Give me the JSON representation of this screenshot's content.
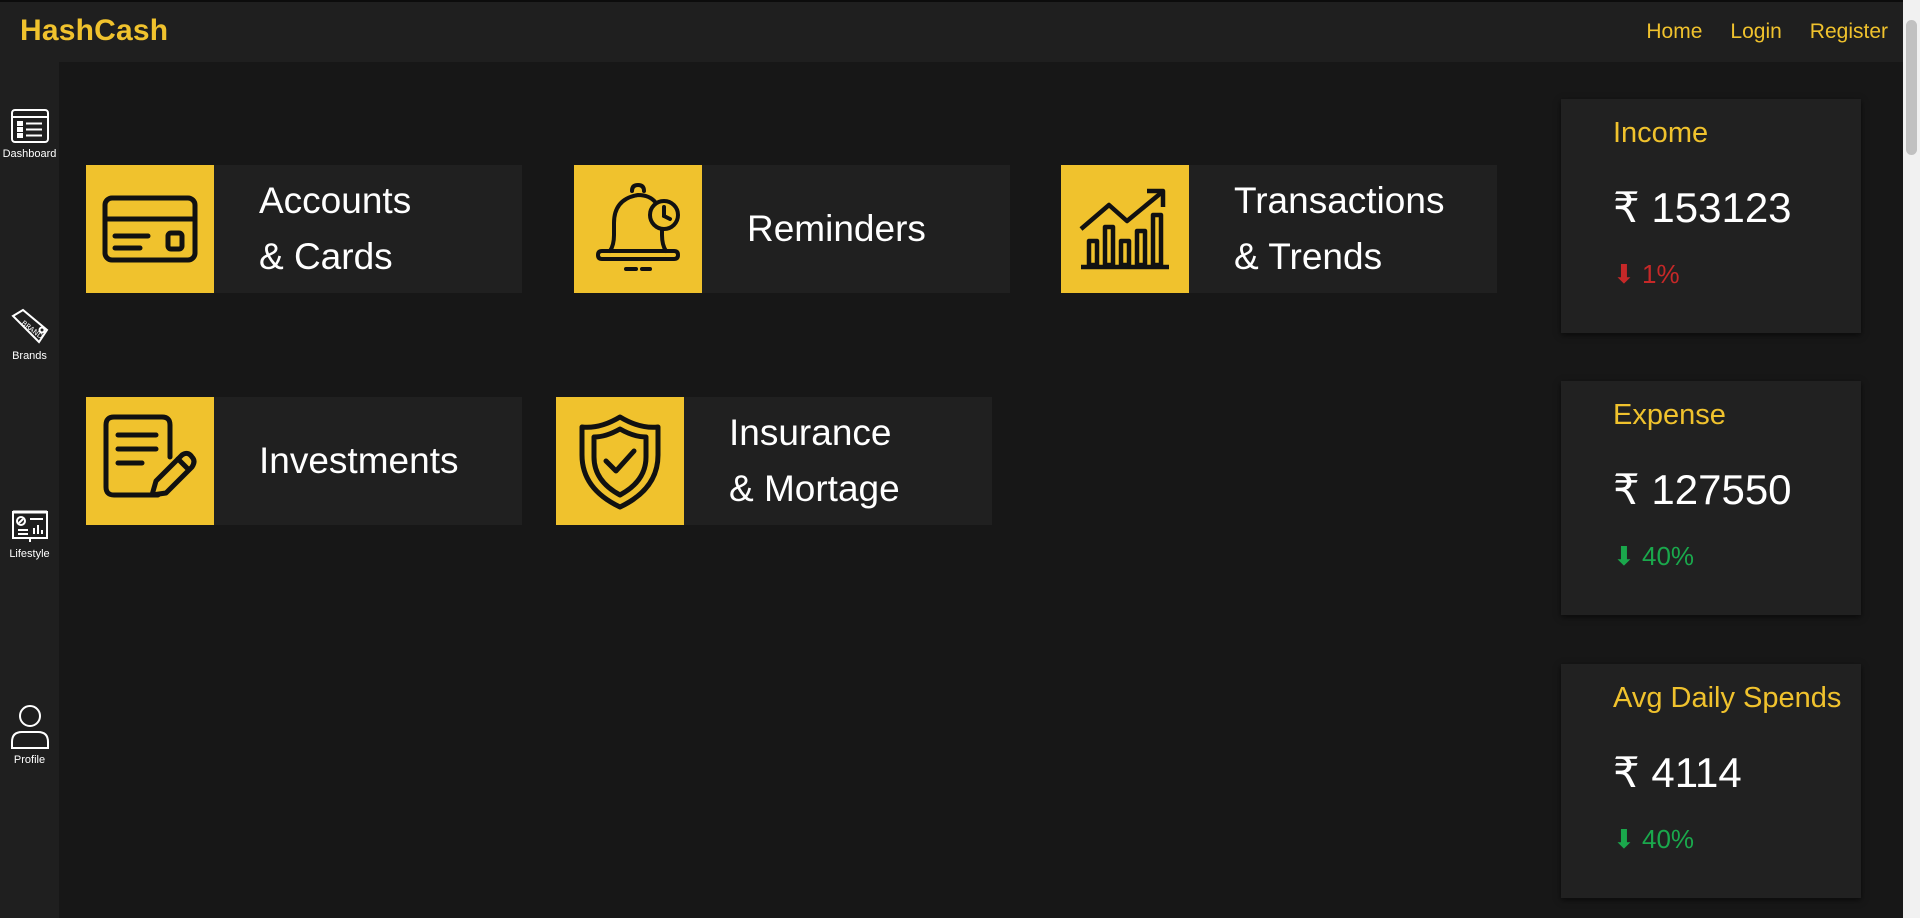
{
  "app": {
    "brand": "HashCash"
  },
  "nav": {
    "home": "Home",
    "login": "Login",
    "register": "Register"
  },
  "sidebar": {
    "items": [
      {
        "label": "Dashboard",
        "icon": "dashboard-list-icon"
      },
      {
        "label": "Brands",
        "icon": "brand-tag-icon"
      },
      {
        "label": "Lifestyle",
        "icon": "lifestyle-board-icon"
      },
      {
        "label": "Profile",
        "icon": "user-icon"
      }
    ]
  },
  "tiles": [
    {
      "line1": "Accounts",
      "line2": "& Cards",
      "icon": "credit-card-icon"
    },
    {
      "line1": "Reminders",
      "line2": "",
      "icon": "bell-clock-icon"
    },
    {
      "line1": "Transactions",
      "line2": "& Trends",
      "icon": "bar-chart-trend-icon"
    },
    {
      "line1": "Investments",
      "line2": "",
      "icon": "document-pen-icon"
    },
    {
      "line1": "Insurance",
      "line2": "& Mortage",
      "icon": "shield-check-icon"
    }
  ],
  "stats": [
    {
      "title": "Income",
      "value": "₹ 153123",
      "change": "⬇ 1%",
      "trend_color": "#c62828"
    },
    {
      "title": "Expense",
      "value": "₹ 127550",
      "change": "⬇ 40%",
      "trend_color": "#1aa84c"
    },
    {
      "title": "Avg Daily Spends",
      "value": "₹ 4114",
      "change": "⬇ 40%",
      "trend_color": "#1aa84c"
    }
  ],
  "colors": {
    "accent": "#f0c22d",
    "background": "#171717",
    "panel": "#202020"
  }
}
